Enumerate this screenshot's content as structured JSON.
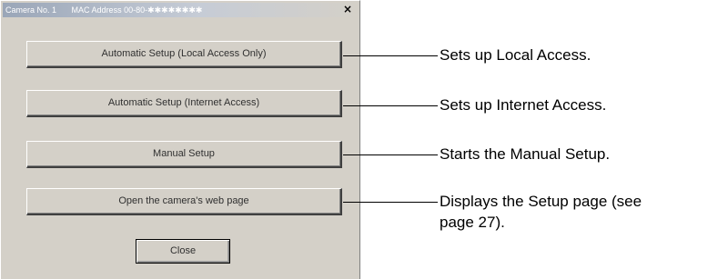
{
  "dialog": {
    "title_camera": "Camera No. 1",
    "title_mac": "MAC Address  00-80-✱✱✱✱✱✱✱✱",
    "close_icon": "close-icon",
    "buttons": [
      {
        "label": "Automatic Setup (Local Access Only)"
      },
      {
        "label": "Automatic Setup (Internet Access)"
      },
      {
        "label": "Manual Setup"
      },
      {
        "label": "Open the camera's web page"
      }
    ],
    "close_label": "Close"
  },
  "annotations": [
    {
      "text": "Sets up Local Access."
    },
    {
      "text": "Sets up Internet Access."
    },
    {
      "text": "Starts the Manual Setup."
    },
    {
      "text_line1": "Displays the Setup page (see",
      "text_line2": "page 27)."
    }
  ]
}
